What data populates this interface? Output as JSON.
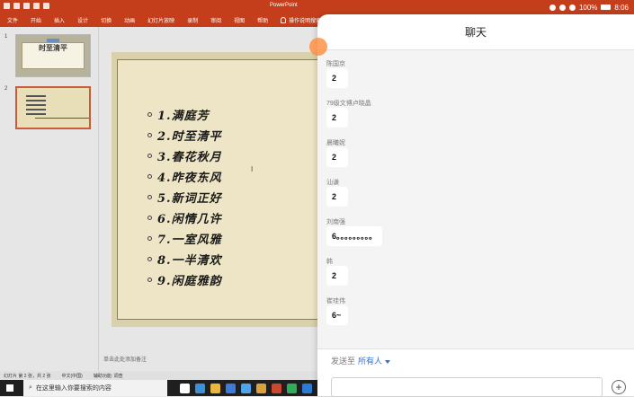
{
  "titlebar": {
    "title": "PowerPoint"
  },
  "ribbon": {
    "tabs": [
      "文件",
      "开始",
      "插入",
      "设计",
      "切换",
      "动画",
      "幻灯片放映",
      "录制",
      "审阅",
      "视图",
      "帮助"
    ],
    "tell_me": "操作说明搜索"
  },
  "status_top": {
    "battery": "100%",
    "time": "8:06"
  },
  "thumbnails": [
    {
      "num": "1",
      "title": "时至清平"
    },
    {
      "num": "2"
    }
  ],
  "slide": {
    "items": [
      "1.满庭芳",
      "2.时至清平",
      "3.春花秋月",
      "4.昨夜东风",
      "5.新词正好",
      "6.闲情几许",
      "7.一室风雅",
      "8.一半清欢",
      "9.闲庭雅韵"
    ]
  },
  "notes_placeholder": "单击此处添加备注",
  "ppt_status": {
    "slide_count": "幻灯片 第 2 张，共 2 张",
    "language": "中文(中国)",
    "accessibility": "辅助功能: 调查"
  },
  "taskbar": {
    "search_placeholder": "在这里输入你要搜索的内容"
  },
  "chat": {
    "title": "聊天",
    "messages": [
      {
        "sender": "陈国京",
        "text": "2"
      },
      {
        "sender": "79级文博卢晓晶",
        "text": "2"
      },
      {
        "sender": "晨曦妮",
        "text": "2"
      },
      {
        "sender": "汕谦",
        "text": "2"
      },
      {
        "sender": "刘南强",
        "text": "6。。。。。。。。。"
      },
      {
        "sender": "韩",
        "text": "2"
      },
      {
        "sender": "崔珪伟",
        "text": "6~"
      }
    ],
    "send_to_label": "发送至",
    "send_to_target": "所有人",
    "input_value": "",
    "plus_icon": "+"
  },
  "colors": {
    "ppt_red": "#c43e1c",
    "chat_accent": "#2d6fe0"
  }
}
